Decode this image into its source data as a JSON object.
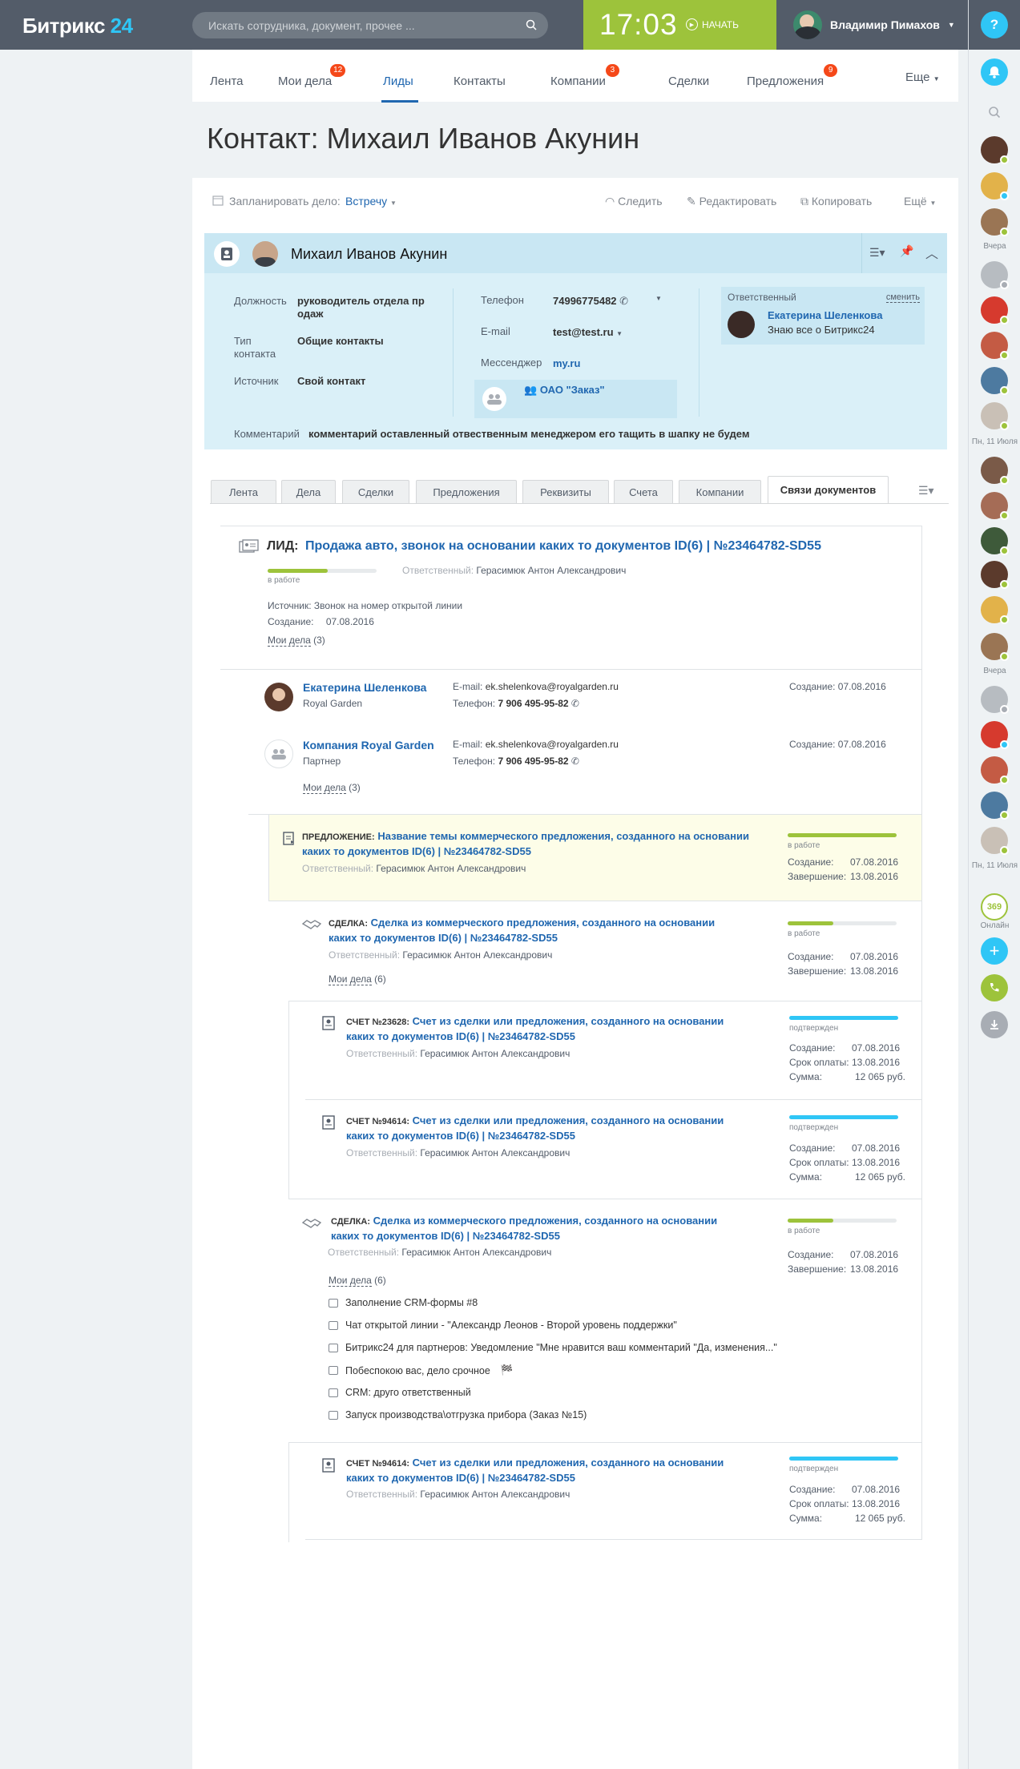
{
  "header": {
    "logo_main": "Битрикс",
    "logo_num": "24",
    "search_placeholder": "Искать сотрудника, документ, прочее ...",
    "time": "17:03",
    "start_label": "НАЧАТЬ",
    "user_name": "Владимир Пимахов",
    "help": "?"
  },
  "nav": [
    {
      "label": "Лента",
      "badge": ""
    },
    {
      "label": "Мои дела",
      "badge": "12"
    },
    {
      "label": "Лиды",
      "badge": ""
    },
    {
      "label": "Контакты",
      "badge": ""
    },
    {
      "label": "Компании",
      "badge": "3"
    },
    {
      "label": "Сделки",
      "badge": ""
    },
    {
      "label": "Предложения",
      "badge": "9"
    },
    {
      "label": "Еще",
      "badge": ""
    }
  ],
  "page_title": "Контакт: Михаил Иванов Акунин",
  "toolbar": {
    "plan_label": "Запланировать дело:",
    "plan_value": "Встречу",
    "follow": "Следить",
    "edit": "Редактировать",
    "copy": "Копировать",
    "more": "Ещё"
  },
  "contact": {
    "name": "Михаил Иванов Акунин",
    "position_label": "Должность",
    "position_value_1": "руководитель отдела пр",
    "position_value_2": "одаж",
    "type_label_1": "Тип",
    "type_label_2": "контакта",
    "type_value": "Общие контакты",
    "source_label": "Источник",
    "source_value": "Свой контакт",
    "phone_label": "Телефон",
    "phone_value": "74996775482",
    "email_label": "E-mail",
    "email_value": "test@test.ru",
    "messenger_label": "Мессенджер",
    "messenger_value": "my.ru",
    "company": "ОАО \"Заказ\"",
    "responsible_label": "Ответственный",
    "responsible_change": "сменить",
    "responsible_name": "Екатерина Шеленкова",
    "responsible_note": "Знаю все о Битрикс24",
    "comment_label": "Комментарий",
    "comment_value": "комментарий оставленный отвественным менеджером его тащить в шапку не будем"
  },
  "tabs": [
    "Лента",
    "Дела",
    "Сделки",
    "Предложения",
    "Реквизиты",
    "Счета",
    "Компании",
    "Связи документов"
  ],
  "lead": {
    "prefix": "ЛИД:",
    "title": "Продажа авто, звонок на основании каких то документов ID(6) | №23464782-SD55",
    "status": "в работе",
    "resp_label": "Ответственный:",
    "resp_name": "Герасимюк Антон Александрович",
    "source_label": "Источник:",
    "source_value": "Звонок на номер открытой линии",
    "created_label": "Создание:",
    "created_value": "07.08.2016",
    "tasks_label": "Мои дела",
    "tasks_count": "(3)",
    "progress": 0.55
  },
  "person": {
    "name": "Екатерина Шеленкова",
    "company": "Royal Garden",
    "email_label": "E-mail:",
    "email": "ek.shelenkova@royalgarden.ru",
    "phone_label": "Телефон:",
    "phone": "7 906 495-95-82",
    "created": "Создание: 07.08.2016"
  },
  "company_item": {
    "name": "Компания Royal Garden",
    "role": "Партнер",
    "email_label": "E-mail:",
    "email": "ek.shelenkova@royalgarden.ru",
    "phone_label": "Телефон:",
    "phone": "7 906 495-95-82",
    "created": "Создание: 07.08.2016",
    "tasks_label": "Мои дела",
    "tasks_count": "(3)"
  },
  "offer": {
    "prefix": "ПРЕДЛОЖЕНИЕ:",
    "title_1": "Название темы коммерческого предложения, созданного на основании",
    "title_2": "каких то документов ID(6) | №23464782-SD55",
    "resp_label": "Ответственный:",
    "resp_name": "Герасимюк Антон Александрович",
    "status": "в работе",
    "created_label": "Создание:",
    "created_value": "07.08.2016",
    "finish_label": "Завершение:",
    "finish_value": "13.08.2016",
    "progress": 1.0
  },
  "deal1": {
    "prefix": "СДЕЛКА:",
    "title_1": "Сделка из коммерческого предложения, созданного на основании",
    "title_2": "каких то документов ID(6) | №23464782-SD55",
    "resp_label": "Ответственный:",
    "resp_name": "Герасимюк Антон Александрович",
    "tasks_label": "Мои дела",
    "tasks_count": "(6)",
    "status": "в работе",
    "created_label": "Создание:",
    "created_value": "07.08.2016",
    "finish_label": "Завершение:",
    "finish_value": "13.08.2016",
    "progress": 0.42
  },
  "invoice1": {
    "prefix": "СЧЕТ №23628:",
    "title_1": "Счет из сделки или предложения, созданного на основании",
    "title_2": "каких то документов ID(6) | №23464782-SD55",
    "resp_label": "Ответственный:",
    "resp_name": "Герасимюк Антон Александрович",
    "status": "подтвержден",
    "created_label": "Создание:",
    "created_value": "07.08.2016",
    "due_label": "Срок оплаты:",
    "due_value": "13.08.2016",
    "sum_label": "Сумма:",
    "sum_value": "12 065 руб.",
    "progress": 1.0
  },
  "invoice2": {
    "prefix": "СЧЕТ №94614:",
    "title_1": "Счет из сделки или предложения, созданного на основании",
    "title_2": "каких то документов ID(6) | №23464782-SD55",
    "resp_label": "Ответственный:",
    "resp_name": "Герасимюк Антон Александрович",
    "status": "подтвержден",
    "created_label": "Создание:",
    "created_value": "07.08.2016",
    "due_label": "Срок оплаты:",
    "due_value": "13.08.2016",
    "sum_label": "Сумма:",
    "sum_value": "12 065 руб.",
    "progress": 1.0
  },
  "deal2": {
    "prefix": "СДЕЛКА:",
    "title_1": "Сделка из коммерческого предложения, созданного на основании",
    "title_2": "каких то документов ID(6) | №23464782-SD55",
    "resp_label": "Ответственный:",
    "resp_name": "Герасимюк Антон Александрович",
    "tasks_label": "Мои дела",
    "tasks_count": "(6)",
    "status": "в работе",
    "created_label": "Создание:",
    "created_value": "07.08.2016",
    "finish_label": "Завершение:",
    "finish_value": "13.08.2016",
    "progress": 0.42,
    "activities": [
      "Заполнение CRM-формы #8",
      "Чат открытой линии - \"Александр Леонов - Второй уровень поддержки\"",
      "Битрикс24 для партнеров: Уведомление \"Мне нравится ваш комментарий \"Да, изменения...\"",
      "Побеспокою вас, дело срочное",
      "CRM: друго ответственный",
      "Запуск производства\\отгрузка прибора (Заказ №15)"
    ]
  },
  "invoice3": {
    "prefix": "СЧЕТ №94614:",
    "title_1": "Счет из сделки или предложения, созданного на основании",
    "title_2": "каких то документов ID(6) | №23464782-SD55",
    "resp_label": "Ответственный:",
    "resp_name": "Герасимюк Антон Александрович",
    "status": "подтвержден",
    "created_label": "Создание:",
    "created_value": "07.08.2016",
    "due_label": "Срок оплаты:",
    "due_value": "13.08.2016",
    "sum_label": "Сумма:",
    "sum_value": "12 065 руб.",
    "progress": 1.0
  },
  "rail": {
    "label_yesterday": "Вчера",
    "label_date": "Пн, 11 Июля",
    "online_count": "369",
    "online_label": "Онлайн"
  },
  "colors": {
    "accent": "#2067b0",
    "green": "#9dc33b",
    "cyan": "#2fc6f6",
    "header": "#535c69"
  }
}
